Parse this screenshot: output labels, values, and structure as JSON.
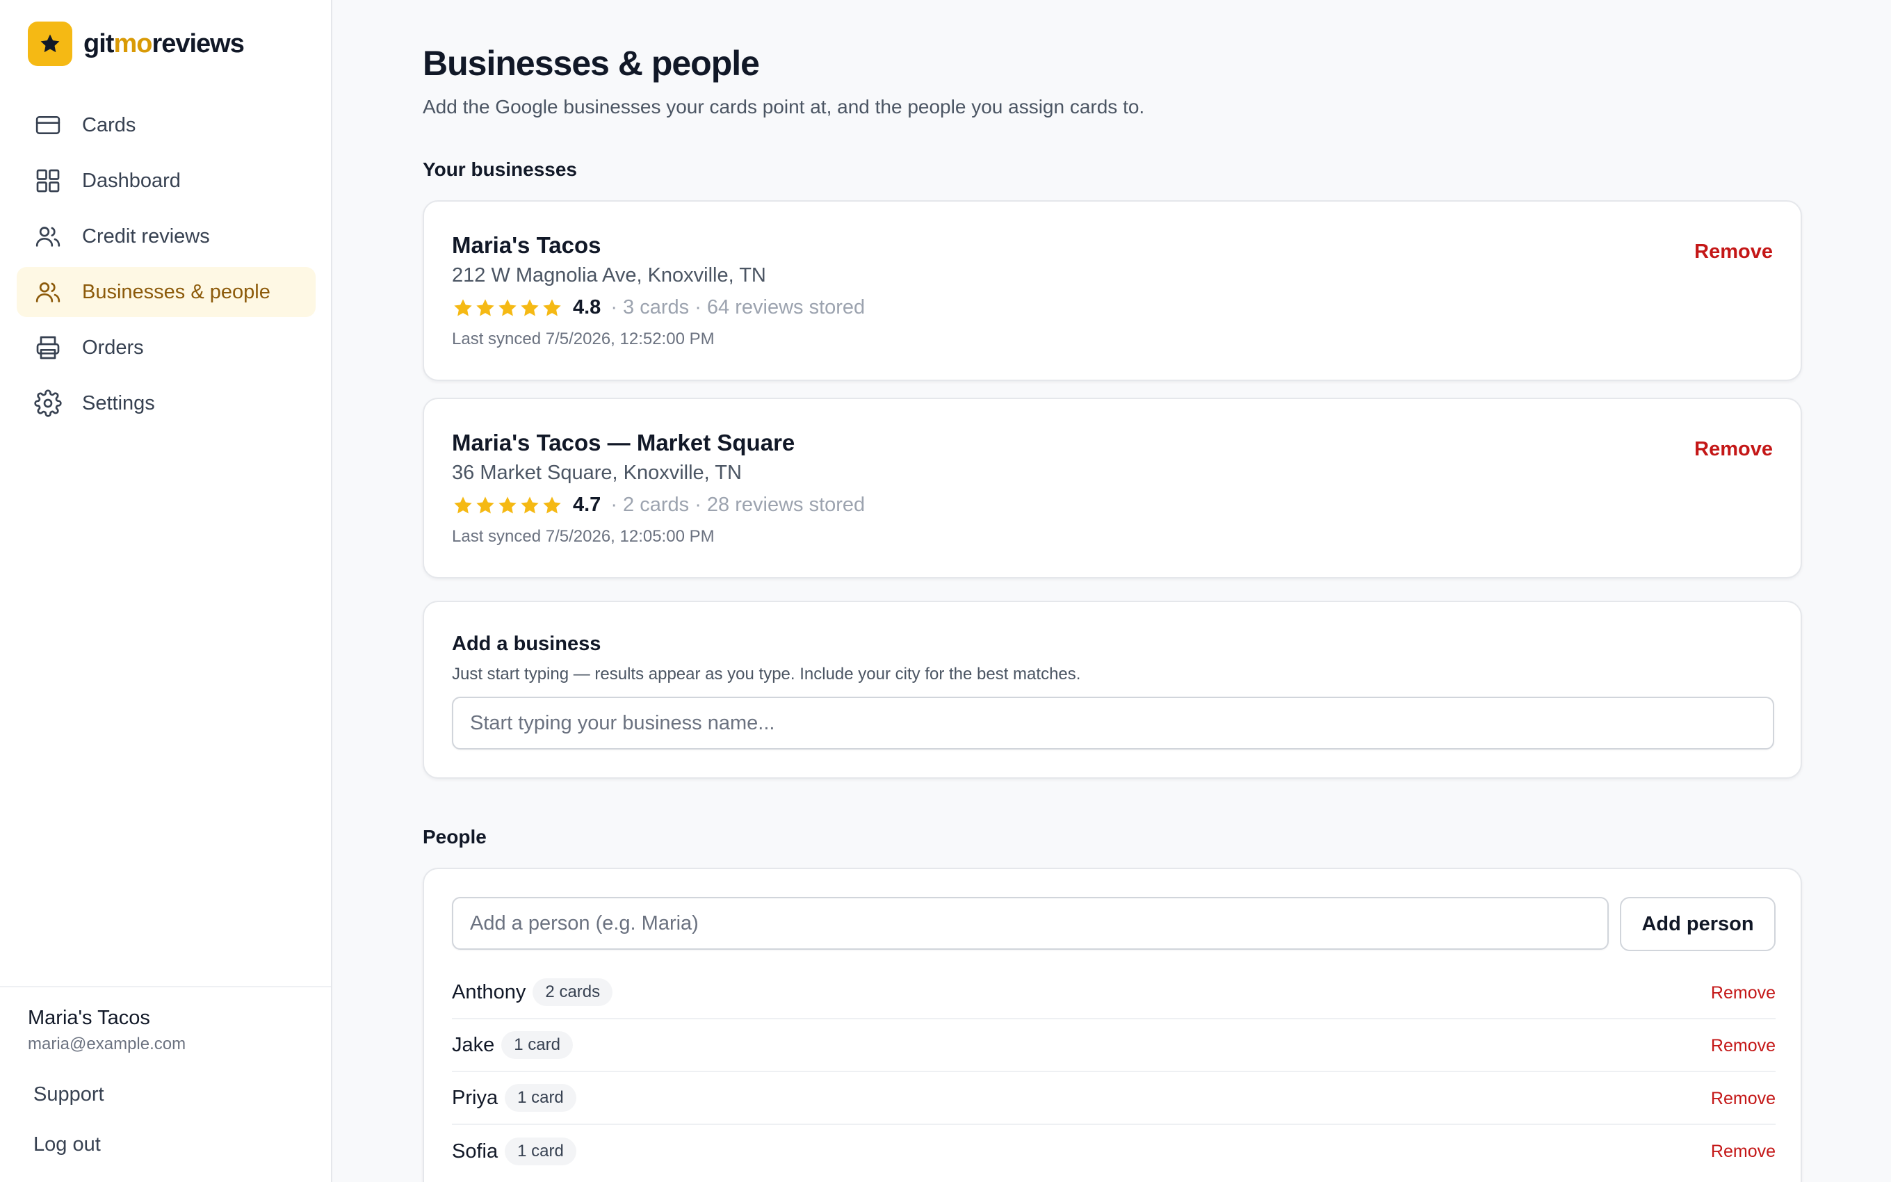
{
  "brand": {
    "prefix": "git",
    "accent": "mo",
    "suffix": "reviews",
    "logo_icon": "star-icon",
    "logo_color": "#f5b914"
  },
  "sidebar": {
    "items": [
      {
        "label": "Cards",
        "icon": "card-icon",
        "active": false
      },
      {
        "label": "Dashboard",
        "icon": "grid-icon",
        "active": false
      },
      {
        "label": "Credit reviews",
        "icon": "users-icon",
        "active": false
      },
      {
        "label": "Businesses & people",
        "icon": "users-icon",
        "active": true
      },
      {
        "label": "Orders",
        "icon": "printer-icon",
        "active": false
      },
      {
        "label": "Settings",
        "icon": "gear-icon",
        "active": false
      }
    ],
    "account_name": "Maria's Tacos",
    "account_email": "maria@example.com",
    "support_label": "Support",
    "logout_label": "Log out"
  },
  "main": {
    "title": "Businesses & people",
    "subtitle": "Add the Google businesses your cards point at, and the people you assign cards to.",
    "businesses_heading": "Your businesses",
    "businesses": [
      {
        "name": "Maria's Tacos",
        "address": "212 W Magnolia Ave, Knoxville, TN",
        "rating": "4.8",
        "meta": "· 3 cards · 64 reviews stored",
        "synced": "Last synced 7/5/2026, 12:52:00 PM",
        "remove_label": "Remove"
      },
      {
        "name": "Maria's Tacos — Market Square",
        "address": "36 Market Square, Knoxville, TN",
        "rating": "4.7",
        "meta": "· 2 cards · 28 reviews stored",
        "synced": "Last synced 7/5/2026, 12:05:00 PM",
        "remove_label": "Remove"
      }
    ],
    "add_business": {
      "title": "Add a business",
      "hint": "Just start typing — results appear as you type. Include your city for the best matches.",
      "placeholder": "Start typing your business name...",
      "value": ""
    },
    "people_heading": "People",
    "people_input": {
      "placeholder": "Add a person (e.g. Maria)",
      "value": ""
    },
    "add_person_label": "Add person",
    "people": [
      {
        "name": "Anthony",
        "badge": "2 cards",
        "remove_label": "Remove"
      },
      {
        "name": "Jake",
        "badge": "1 card",
        "remove_label": "Remove"
      },
      {
        "name": "Priya",
        "badge": "1 card",
        "remove_label": "Remove"
      },
      {
        "name": "Sofia",
        "badge": "1 card",
        "remove_label": "Remove"
      }
    ]
  },
  "colors": {
    "accent": "#f5b914",
    "active_text": "#8c5a0a",
    "active_bg": "#fef8e4",
    "danger": "#c41717"
  }
}
